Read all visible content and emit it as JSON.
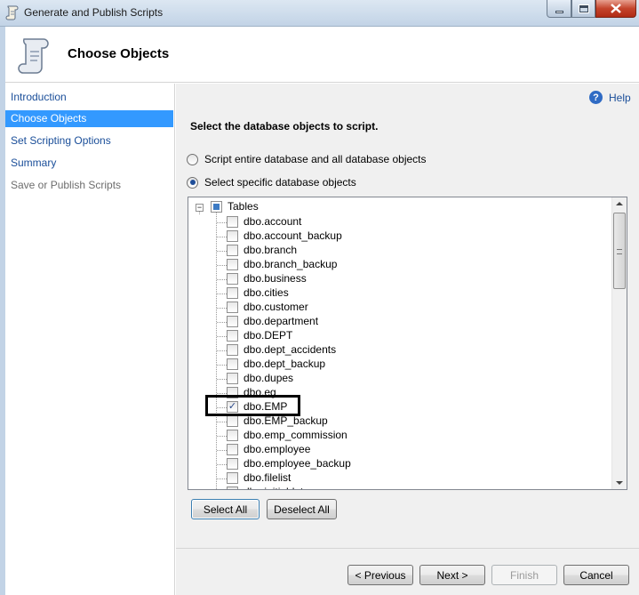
{
  "window": {
    "title": "Generate and Publish Scripts",
    "app_icon": "scroll-icon",
    "controls": [
      "minimize-icon",
      "maximize-icon",
      "close-icon"
    ]
  },
  "header": {
    "icon": "scroll-icon",
    "title": "Choose Objects"
  },
  "sidebar": {
    "items": [
      {
        "label": "Introduction",
        "state": "link"
      },
      {
        "label": "Choose Objects",
        "state": "selected"
      },
      {
        "label": "Set Scripting Options",
        "state": "link"
      },
      {
        "label": "Summary",
        "state": "link"
      },
      {
        "label": "Save or Publish Scripts",
        "state": "disabled"
      }
    ]
  },
  "main": {
    "help_label": "Help",
    "instructions": "Select the database objects to script.",
    "options": [
      {
        "label": "Script entire database and all database objects",
        "selected": false
      },
      {
        "label": "Select specific database objects",
        "selected": true
      }
    ],
    "tree": {
      "root_label": "Tables",
      "root_state": "partial",
      "items": [
        {
          "label": "dbo.account",
          "checked": false
        },
        {
          "label": "dbo.account_backup",
          "checked": false
        },
        {
          "label": "dbo.branch",
          "checked": false
        },
        {
          "label": "dbo.branch_backup",
          "checked": false
        },
        {
          "label": "dbo.business",
          "checked": false
        },
        {
          "label": "dbo.cities",
          "checked": false
        },
        {
          "label": "dbo.customer",
          "checked": false
        },
        {
          "label": "dbo.department",
          "checked": false
        },
        {
          "label": "dbo.DEPT",
          "checked": false
        },
        {
          "label": "dbo.dept_accidents",
          "checked": false
        },
        {
          "label": "dbo.dept_backup",
          "checked": false
        },
        {
          "label": "dbo.dupes",
          "checked": false
        },
        {
          "label": "dbo.eg",
          "checked": false
        },
        {
          "label": "dbo.EMP",
          "checked": true
        },
        {
          "label": "dbo.EMP_backup",
          "checked": false
        },
        {
          "label": "dbo.emp_commission",
          "checked": false
        },
        {
          "label": "dbo.employee",
          "checked": false
        },
        {
          "label": "dbo.employee_backup",
          "checked": false
        },
        {
          "label": "dbo.filelist",
          "checked": false
        },
        {
          "label": "dbo.initialdata",
          "checked": false
        }
      ]
    },
    "select_all_label": "Select All",
    "deselect_all_label": "Deselect All"
  },
  "footer": {
    "previous_label": "< Previous",
    "next_label": "Next >",
    "finish_label": "Finish",
    "cancel_label": "Cancel"
  }
}
